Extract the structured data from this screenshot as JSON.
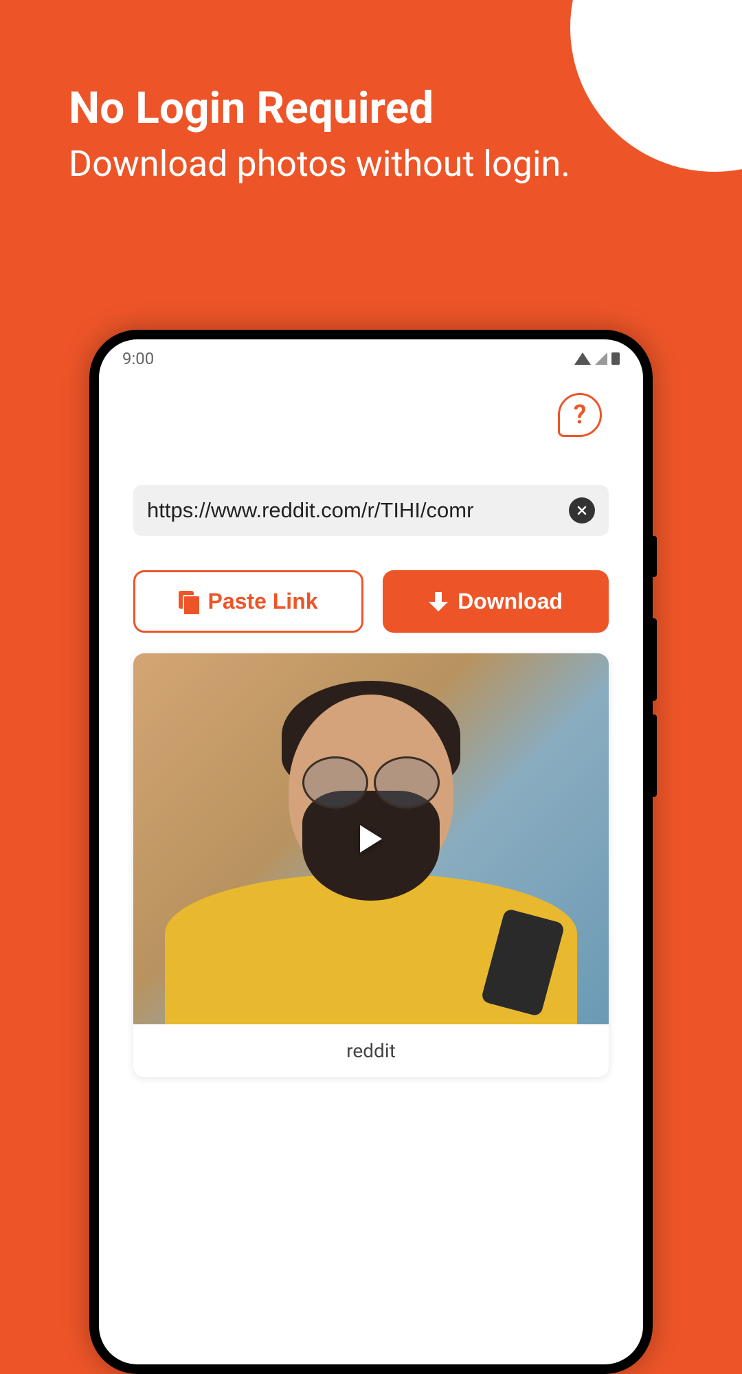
{
  "promo": {
    "title": "No Login Required",
    "subtitle": "Download photos without login."
  },
  "statusBar": {
    "time": "9:00"
  },
  "urlInput": {
    "value": "https://www.reddit.com/r/TIHI/comr"
  },
  "buttons": {
    "pasteLink": "Paste Link",
    "download": "Download"
  },
  "videoCard": {
    "label": "reddit"
  },
  "help": {
    "symbol": "?"
  }
}
